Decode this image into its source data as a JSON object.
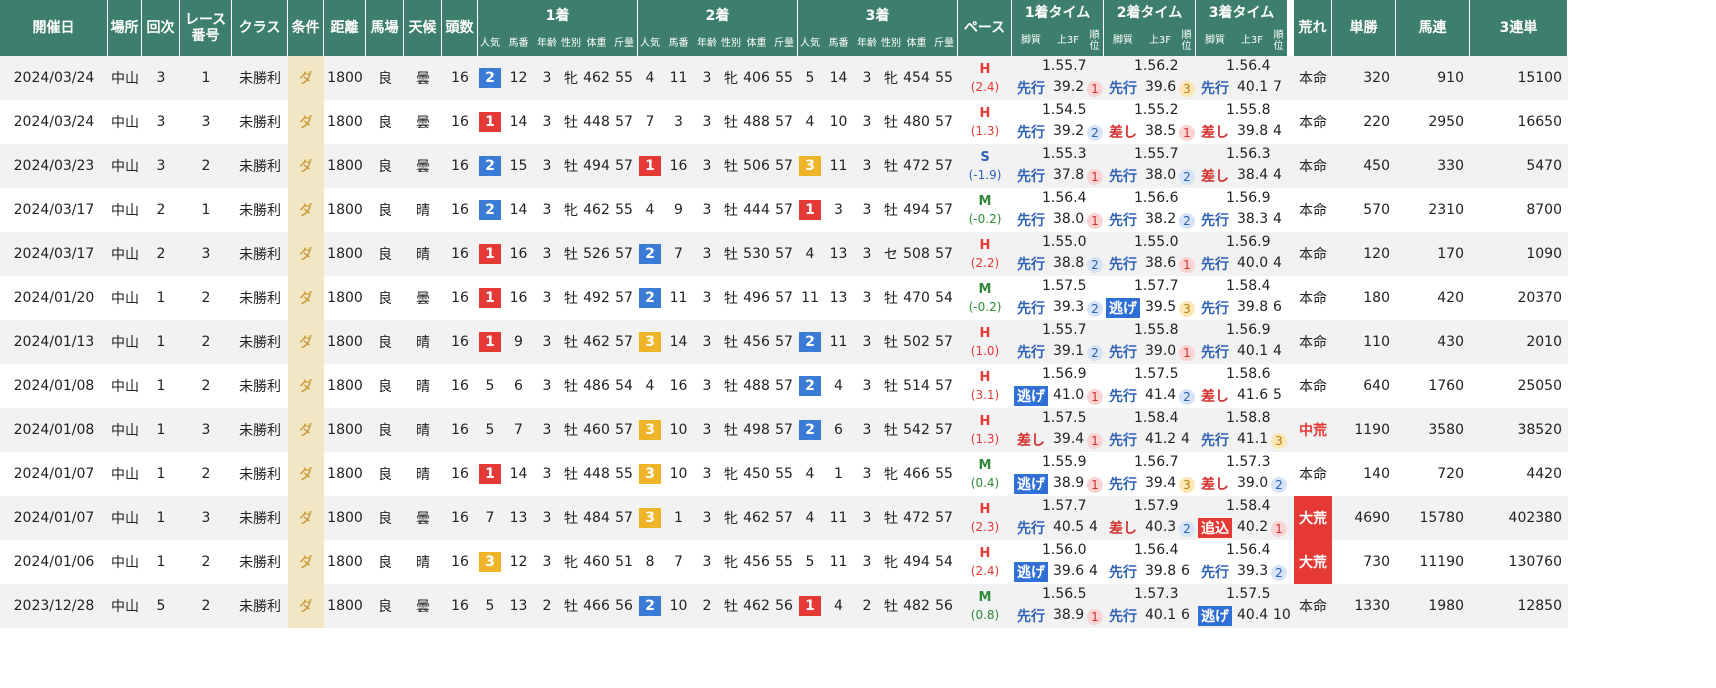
{
  "headers": {
    "date": "開催日",
    "place": "場所",
    "kai": "回次",
    "race_no": "レース番号",
    "class": "クラス",
    "cond": "条件",
    "dist": "距離",
    "track": "馬場",
    "weather": "天候",
    "count": "頭数",
    "first": "1着",
    "second": "2着",
    "third": "3着",
    "pace": "ペース",
    "t1": "1着タイム",
    "t2": "2着タイム",
    "t3": "3着タイム",
    "rough": "荒れ",
    "tansho": "単勝",
    "umaren": "馬連",
    "sanrentan": "3連単",
    "sub_horse": [
      "人気",
      "馬番",
      "年齢",
      "性別",
      "体重",
      "斤量"
    ],
    "sub_time": [
      "脚質",
      "上3F"
    ],
    "rank": "順位"
  },
  "rows": [
    {
      "date": "2024/03/24",
      "place": "中山",
      "kai": "3",
      "race_no": "1",
      "cls": "未勝利",
      "cond": "ダ",
      "dist": "1800",
      "track": "良",
      "weather": "曇",
      "count": "16",
      "h": [
        [
          "2",
          "12",
          "3",
          "牝",
          "462",
          "55"
        ],
        [
          "4",
          "11",
          "3",
          "牝",
          "406",
          "55"
        ],
        [
          "5",
          "14",
          "3",
          "牝",
          "454",
          "55"
        ]
      ],
      "pace": "H",
      "dev": "(2.4)",
      "t": [
        [
          "1.55.7",
          "先行",
          "39.2",
          "1"
        ],
        [
          "1.56.2",
          "先行",
          "39.6",
          "3"
        ],
        [
          "1.56.4",
          "先行",
          "40.1",
          "7"
        ]
      ],
      "rough": "本命",
      "tan": "320",
      "uma": "910",
      "san": "15100"
    },
    {
      "date": "2024/03/24",
      "place": "中山",
      "kai": "3",
      "race_no": "3",
      "cls": "未勝利",
      "cond": "ダ",
      "dist": "1800",
      "track": "良",
      "weather": "曇",
      "count": "16",
      "h": [
        [
          "1",
          "14",
          "3",
          "牡",
          "448",
          "57"
        ],
        [
          "7",
          "3",
          "3",
          "牡",
          "488",
          "57"
        ],
        [
          "4",
          "10",
          "3",
          "牡",
          "480",
          "57"
        ]
      ],
      "pace": "H",
      "dev": "(1.3)",
      "t": [
        [
          "1.54.5",
          "先行",
          "39.2",
          "2"
        ],
        [
          "1.55.2",
          "差し",
          "38.5",
          "1"
        ],
        [
          "1.55.8",
          "差し",
          "39.8",
          "4"
        ]
      ],
      "rough": "本命",
      "tan": "220",
      "uma": "2950",
      "san": "16650"
    },
    {
      "date": "2024/03/23",
      "place": "中山",
      "kai": "3",
      "race_no": "2",
      "cls": "未勝利",
      "cond": "ダ",
      "dist": "1800",
      "track": "良",
      "weather": "曇",
      "count": "16",
      "h": [
        [
          "2",
          "15",
          "3",
          "牡",
          "494",
          "57"
        ],
        [
          "1",
          "16",
          "3",
          "牡",
          "506",
          "57"
        ],
        [
          "3",
          "11",
          "3",
          "牡",
          "472",
          "57"
        ]
      ],
      "pace": "S",
      "dev": "(-1.9)",
      "t": [
        [
          "1.55.3",
          "先行",
          "37.8",
          "1"
        ],
        [
          "1.55.7",
          "先行",
          "38.0",
          "2"
        ],
        [
          "1.56.3",
          "差し",
          "38.4",
          "4"
        ]
      ],
      "rough": "本命",
      "tan": "450",
      "uma": "330",
      "san": "5470"
    },
    {
      "date": "2024/03/17",
      "place": "中山",
      "kai": "2",
      "race_no": "1",
      "cls": "未勝利",
      "cond": "ダ",
      "dist": "1800",
      "track": "良",
      "weather": "晴",
      "count": "16",
      "h": [
        [
          "2",
          "14",
          "3",
          "牝",
          "462",
          "55"
        ],
        [
          "4",
          "9",
          "3",
          "牡",
          "444",
          "57"
        ],
        [
          "1",
          "3",
          "3",
          "牡",
          "494",
          "57"
        ]
      ],
      "pace": "M",
      "dev": "(-0.2)",
      "t": [
        [
          "1.56.4",
          "先行",
          "38.0",
          "1"
        ],
        [
          "1.56.6",
          "先行",
          "38.2",
          "2"
        ],
        [
          "1.56.9",
          "先行",
          "38.3",
          "4"
        ]
      ],
      "rough": "本命",
      "tan": "570",
      "uma": "2310",
      "san": "8700"
    },
    {
      "date": "2024/03/17",
      "place": "中山",
      "kai": "2",
      "race_no": "3",
      "cls": "未勝利",
      "cond": "ダ",
      "dist": "1800",
      "track": "良",
      "weather": "晴",
      "count": "16",
      "h": [
        [
          "1",
          "16",
          "3",
          "牡",
          "526",
          "57"
        ],
        [
          "2",
          "7",
          "3",
          "牡",
          "530",
          "57"
        ],
        [
          "4",
          "13",
          "3",
          "セ",
          "508",
          "57"
        ]
      ],
      "pace": "H",
      "dev": "(2.2)",
      "t": [
        [
          "1.55.0",
          "先行",
          "38.8",
          "2"
        ],
        [
          "1.55.0",
          "先行",
          "38.6",
          "1"
        ],
        [
          "1.56.9",
          "先行",
          "40.0",
          "4"
        ]
      ],
      "rough": "本命",
      "tan": "120",
      "uma": "170",
      "san": "1090"
    },
    {
      "date": "2024/01/20",
      "place": "中山",
      "kai": "1",
      "race_no": "2",
      "cls": "未勝利",
      "cond": "ダ",
      "dist": "1800",
      "track": "良",
      "weather": "曇",
      "count": "16",
      "h": [
        [
          "1",
          "16",
          "3",
          "牡",
          "492",
          "57"
        ],
        [
          "2",
          "11",
          "3",
          "牡",
          "496",
          "57"
        ],
        [
          "11",
          "13",
          "3",
          "牡",
          "470",
          "54"
        ]
      ],
      "pace": "M",
      "dev": "(-0.2)",
      "t": [
        [
          "1.57.5",
          "先行",
          "39.3",
          "2"
        ],
        [
          "1.57.7",
          "逃げ",
          "39.5",
          "3"
        ],
        [
          "1.58.4",
          "先行",
          "39.8",
          "6"
        ]
      ],
      "rough": "本命",
      "tan": "180",
      "uma": "420",
      "san": "20370"
    },
    {
      "date": "2024/01/13",
      "place": "中山",
      "kai": "1",
      "race_no": "2",
      "cls": "未勝利",
      "cond": "ダ",
      "dist": "1800",
      "track": "良",
      "weather": "晴",
      "count": "16",
      "h": [
        [
          "1",
          "9",
          "3",
          "牡",
          "462",
          "57"
        ],
        [
          "3",
          "14",
          "3",
          "牡",
          "456",
          "57"
        ],
        [
          "2",
          "11",
          "3",
          "牡",
          "502",
          "57"
        ]
      ],
      "pace": "H",
      "dev": "(1.0)",
      "t": [
        [
          "1.55.7",
          "先行",
          "39.1",
          "2"
        ],
        [
          "1.55.8",
          "先行",
          "39.0",
          "1"
        ],
        [
          "1.56.9",
          "先行",
          "40.1",
          "4"
        ]
      ],
      "rough": "本命",
      "tan": "110",
      "uma": "430",
      "san": "2010"
    },
    {
      "date": "2024/01/08",
      "place": "中山",
      "kai": "1",
      "race_no": "2",
      "cls": "未勝利",
      "cond": "ダ",
      "dist": "1800",
      "track": "良",
      "weather": "晴",
      "count": "16",
      "h": [
        [
          "5",
          "6",
          "3",
          "牡",
          "486",
          "54"
        ],
        [
          "4",
          "16",
          "3",
          "牡",
          "488",
          "57"
        ],
        [
          "2",
          "4",
          "3",
          "牡",
          "514",
          "57"
        ]
      ],
      "pace": "H",
      "dev": "(3.1)",
      "t": [
        [
          "1.56.9",
          "逃げ",
          "41.0",
          "1"
        ],
        [
          "1.57.5",
          "先行",
          "41.4",
          "2"
        ],
        [
          "1.58.6",
          "差し",
          "41.6",
          "5"
        ]
      ],
      "rough": "本命",
      "tan": "640",
      "uma": "1760",
      "san": "25050"
    },
    {
      "date": "2024/01/08",
      "place": "中山",
      "kai": "1",
      "race_no": "3",
      "cls": "未勝利",
      "cond": "ダ",
      "dist": "1800",
      "track": "良",
      "weather": "晴",
      "count": "16",
      "h": [
        [
          "5",
          "7",
          "3",
          "牡",
          "460",
          "57"
        ],
        [
          "3",
          "10",
          "3",
          "牡",
          "498",
          "57"
        ],
        [
          "2",
          "6",
          "3",
          "牡",
          "542",
          "57"
        ]
      ],
      "pace": "H",
      "dev": "(1.3)",
      "t": [
        [
          "1.57.5",
          "差し",
          "39.4",
          "1"
        ],
        [
          "1.58.4",
          "先行",
          "41.2",
          "4"
        ],
        [
          "1.58.8",
          "先行",
          "41.1",
          "3"
        ]
      ],
      "rough": "中荒",
      "tan": "1190",
      "uma": "3580",
      "san": "38520"
    },
    {
      "date": "2024/01/07",
      "place": "中山",
      "kai": "1",
      "race_no": "2",
      "cls": "未勝利",
      "cond": "ダ",
      "dist": "1800",
      "track": "良",
      "weather": "晴",
      "count": "16",
      "h": [
        [
          "1",
          "14",
          "3",
          "牡",
          "448",
          "55"
        ],
        [
          "3",
          "10",
          "3",
          "牝",
          "450",
          "55"
        ],
        [
          "4",
          "1",
          "3",
          "牝",
          "466",
          "55"
        ]
      ],
      "pace": "M",
      "dev": "(0.4)",
      "t": [
        [
          "1.55.9",
          "逃げ",
          "38.9",
          "1"
        ],
        [
          "1.56.7",
          "先行",
          "39.4",
          "3"
        ],
        [
          "1.57.3",
          "差し",
          "39.0",
          "2"
        ]
      ],
      "rough": "本命",
      "tan": "140",
      "uma": "720",
      "san": "4420"
    },
    {
      "date": "2024/01/07",
      "place": "中山",
      "kai": "1",
      "race_no": "3",
      "cls": "未勝利",
      "cond": "ダ",
      "dist": "1800",
      "track": "良",
      "weather": "曇",
      "count": "16",
      "h": [
        [
          "7",
          "13",
          "3",
          "牡",
          "484",
          "57"
        ],
        [
          "3",
          "1",
          "3",
          "牝",
          "462",
          "57"
        ],
        [
          "4",
          "11",
          "3",
          "牡",
          "472",
          "57"
        ]
      ],
      "pace": "H",
      "dev": "(2.3)",
      "t": [
        [
          "1.57.7",
          "先行",
          "40.5",
          "4"
        ],
        [
          "1.57.9",
          "差し",
          "40.3",
          "2"
        ],
        [
          "1.58.4",
          "追込",
          "40.2",
          "1"
        ]
      ],
      "rough": "大荒",
      "tan": "4690",
      "uma": "15780",
      "san": "402380"
    },
    {
      "date": "2024/01/06",
      "place": "中山",
      "kai": "1",
      "race_no": "2",
      "cls": "未勝利",
      "cond": "ダ",
      "dist": "1800",
      "track": "良",
      "weather": "晴",
      "count": "16",
      "h": [
        [
          "3",
          "12",
          "3",
          "牝",
          "460",
          "51"
        ],
        [
          "8",
          "7",
          "3",
          "牝",
          "456",
          "55"
        ],
        [
          "5",
          "11",
          "3",
          "牝",
          "494",
          "54"
        ]
      ],
      "pace": "H",
      "dev": "(2.4)",
      "t": [
        [
          "1.56.0",
          "逃げ",
          "39.6",
          "4"
        ],
        [
          "1.56.4",
          "先行",
          "39.8",
          "6"
        ],
        [
          "1.56.4",
          "先行",
          "39.3",
          "2"
        ]
      ],
      "rough": "大荒",
      "tan": "730",
      "uma": "11190",
      "san": "130760"
    },
    {
      "date": "2023/12/28",
      "place": "中山",
      "kai": "5",
      "race_no": "2",
      "cls": "未勝利",
      "cond": "ダ",
      "dist": "1800",
      "track": "良",
      "weather": "曇",
      "count": "16",
      "h": [
        [
          "5",
          "13",
          "2",
          "牡",
          "466",
          "56"
        ],
        [
          "2",
          "10",
          "2",
          "牡",
          "462",
          "56"
        ],
        [
          "1",
          "4",
          "2",
          "牡",
          "482",
          "56"
        ]
      ],
      "pace": "M",
      "dev": "(0.8)",
      "t": [
        [
          "1.56.5",
          "先行",
          "38.9",
          "1"
        ],
        [
          "1.57.3",
          "先行",
          "40.1",
          "6"
        ],
        [
          "1.57.5",
          "逃げ",
          "40.4",
          "10"
        ]
      ],
      "rough": "本命",
      "tan": "1330",
      "uma": "1980",
      "san": "12850"
    }
  ]
}
